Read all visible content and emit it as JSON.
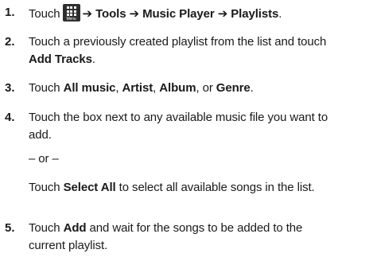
{
  "steps": [
    {
      "number": "1.",
      "touch": "Touch",
      "menu_icon_label": "Menu",
      "arrow": "➔",
      "tools": "Tools",
      "music_player": "Music Player",
      "playlists": "Playlists",
      "period": "."
    },
    {
      "number": "2.",
      "line1": "Touch a previously created playlist from the list and touch",
      "add_tracks": "Add Tracks",
      "period": "."
    },
    {
      "number": "3.",
      "touch": "Touch",
      "all_music": "All music",
      "comma": ", ",
      "artist": "Artist",
      "album": "Album",
      "or": ", or ",
      "genre": "Genre",
      "period": "."
    },
    {
      "number": "4.",
      "line1": "Touch the box next to any available music file you want to",
      "line2": "add.",
      "or_line": "– or –",
      "touch": "Touch",
      "select_all": "Select All",
      "rest": " to select all available songs in the list."
    },
    {
      "number": "5.",
      "touch": "Touch",
      "add": "Add",
      "line1_rest": " and wait for the songs to be added to the",
      "line2": "current playlist."
    }
  ]
}
